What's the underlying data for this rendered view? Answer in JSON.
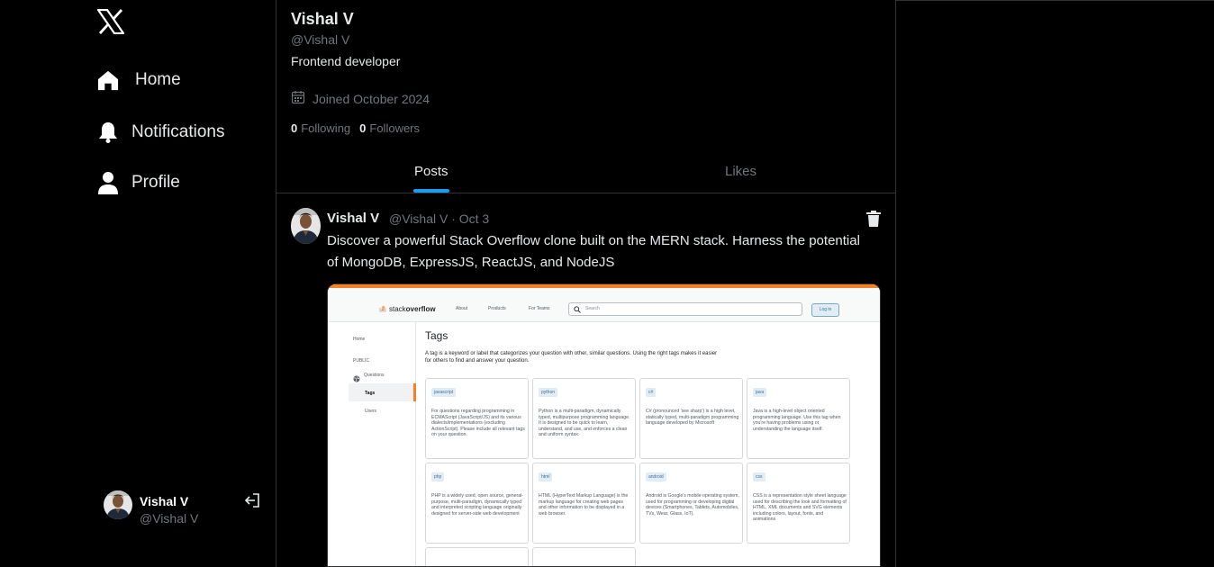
{
  "sidebar": {
    "logo": "X",
    "nav": [
      {
        "label": "Home",
        "icon": "home-icon"
      },
      {
        "label": "Notifications",
        "icon": "bell-icon"
      },
      {
        "label": "Profile",
        "icon": "person-icon"
      }
    ],
    "account": {
      "name": "Vishal V",
      "handle": "@Vishal V"
    }
  },
  "profile": {
    "name": "Vishal V",
    "handle": "@Vishal V",
    "bio": "Frontend developer",
    "joined": "Joined October 2024",
    "following_count": "0",
    "following_label": "Following",
    "followers_count": "0",
    "followers_label": "Followers"
  },
  "tabs": [
    {
      "label": "Posts",
      "active": true
    },
    {
      "label": "Likes",
      "active": false
    }
  ],
  "post": {
    "author": "Vishal V",
    "meta": "@Vishal V · Oct 3",
    "text": "Discover a powerful Stack Overflow clone built on the MERN stack. Harness the potential of MongoDB, ExpressJS, ReactJS, and NodeJS"
  },
  "screenshot": {
    "logo_light": "stack",
    "logo_bold": "overflow",
    "nav": [
      "About",
      "Products",
      "For Teams"
    ],
    "search_placeholder": "Search",
    "login": "Log in",
    "left": {
      "home": "Home",
      "public": "PUBLIC",
      "questions": "Questions",
      "tags": "Tags",
      "users": "Users"
    },
    "title": "Tags",
    "description": "A tag is a keyword or label that categorizes your question with other, similar questions. Using the right tags makes it easier for others to find and answer your question.",
    "cards": [
      {
        "tag": "javascript",
        "text": "For questions regarding programming in ECMAScript (JavaScript/JS) and its various dialects/implementations (excluding ActionScript). Please include all relevant tags on your question."
      },
      {
        "tag": "python",
        "text": "Python is a multi-paradigm, dynamically typed, multipurpose programming language. It is designed to be quick to learn, understand, and use, and enforces a clean and uniform syntax."
      },
      {
        "tag": "c#",
        "text": "C# (pronounced 'see sharp') is a high level, statically typed, multi-paradigm programming language developed by Microsoft"
      },
      {
        "tag": "java",
        "text": "Java is a high-level object oriented programming language. Use this tag when you're having problems using or understanding the language itself."
      },
      {
        "tag": "php",
        "text": "PHP is a widely used, open source, general-purpose, multi-paradigm, dynamically typed and interpreted scripting language originally designed for server-side web development"
      },
      {
        "tag": "html",
        "text": "HTML (HyperText Markup Language) is the markup language for creating web pages and other information to be displayed in a web browser."
      },
      {
        "tag": "android",
        "text": "Android is Google's mobile operating system, used for programming or developing digital devices (Smartphones, Tablets, Automobiles, TVs, Wear, Glass, IoT)."
      },
      {
        "tag": "css",
        "text": "CSS is a representation style sheet language used for describing the look and formatting of HTML, XML documents and SVG elements including colors, layout, fonts, and animations"
      }
    ]
  },
  "colors": {
    "accent": "#1d9bf0",
    "muted": "#71767b",
    "border": "#2f3336",
    "so_orange": "#f48225"
  }
}
